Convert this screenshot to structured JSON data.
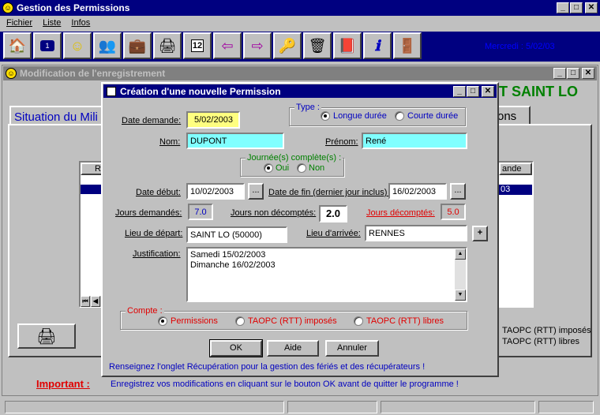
{
  "app": {
    "title": "Gestion des Permissions",
    "menu": [
      "Fichier",
      "Liste",
      "Infos"
    ],
    "date_display": "Mercredi : 5/02/03",
    "toolbar_icons": [
      "home-icon",
      "form-icon",
      "smiley-icon",
      "people-icon",
      "briefcase-icon",
      "printer-icon",
      "calendar-icon",
      "arrow-left-icon",
      "arrow-right-icon",
      "keys-icon",
      "trash-icon",
      "book-icon",
      "info-icon",
      "exit-icon"
    ]
  },
  "modif_window": {
    "title": "Modification de l'enregistrement",
    "header_right": "T SAINT LO",
    "tab_left": "Situation du Mili",
    "tab_right": "ons",
    "table_left_header": "R",
    "table_right_header": "ande",
    "table_right_value": "03",
    "compte_right_1": "TAOPC (RTT) imposés",
    "compte_right_2": "TAOPC (RTT) libres",
    "important_label": "Important :",
    "important_text": "Enregistrez vos modifications en cliquant sur le bouton OK avant de quitter le programme !"
  },
  "dialog": {
    "title": "Création d'une nouvelle Permission",
    "date_demande_label": "Date demande:",
    "date_demande_value": "5/02/2003",
    "type_caption": "Type :",
    "type_longue": "Longue durée",
    "type_courte": "Courte durée",
    "nom_label": "Nom:",
    "nom_value": "DUPONT",
    "prenom_label": "Prénom:",
    "prenom_value": "René",
    "journee_caption": "Journée(s) complète(s) :",
    "journee_oui": "Oui",
    "journee_non": "Non",
    "date_debut_label": "Date début:",
    "date_debut_value": "10/02/2003",
    "date_fin_label": "Date de fin (dernier jour inclus) :",
    "date_fin_value": "16/02/2003",
    "ellipsis": "...",
    "jours_demandes_label": "Jours demandés:",
    "jours_demandes_value": "7.0",
    "jours_non_decomptes_label": "Jours non décomptés:",
    "jours_non_decomptes_value": "2.0",
    "jours_decomptes_label": "Jours décomptés:",
    "jours_decomptes_value": "5.0",
    "lieu_depart_label": "Lieu de départ:",
    "lieu_depart_value": "SAINT LO (50000)",
    "lieu_arrivee_label": "Lieu d'arrivée:",
    "lieu_arrivee_value": "RENNES",
    "plus": "+",
    "justification_label": "Justification:",
    "justification_line1": "Samedi 15/02/2003",
    "justification_line2": "Dimanche 16/02/2003",
    "compte_caption": "Compte :",
    "compte_permissions": "Permissions",
    "compte_imposes": "TAOPC (RTT) imposés",
    "compte_libres": "TAOPC (RTT) libres",
    "ok": "OK",
    "aide": "Aide",
    "annuler": "Annuler",
    "hint": "Renseignez l'onglet Récupération pour la gestion des fériés et des récupérateurs !"
  }
}
